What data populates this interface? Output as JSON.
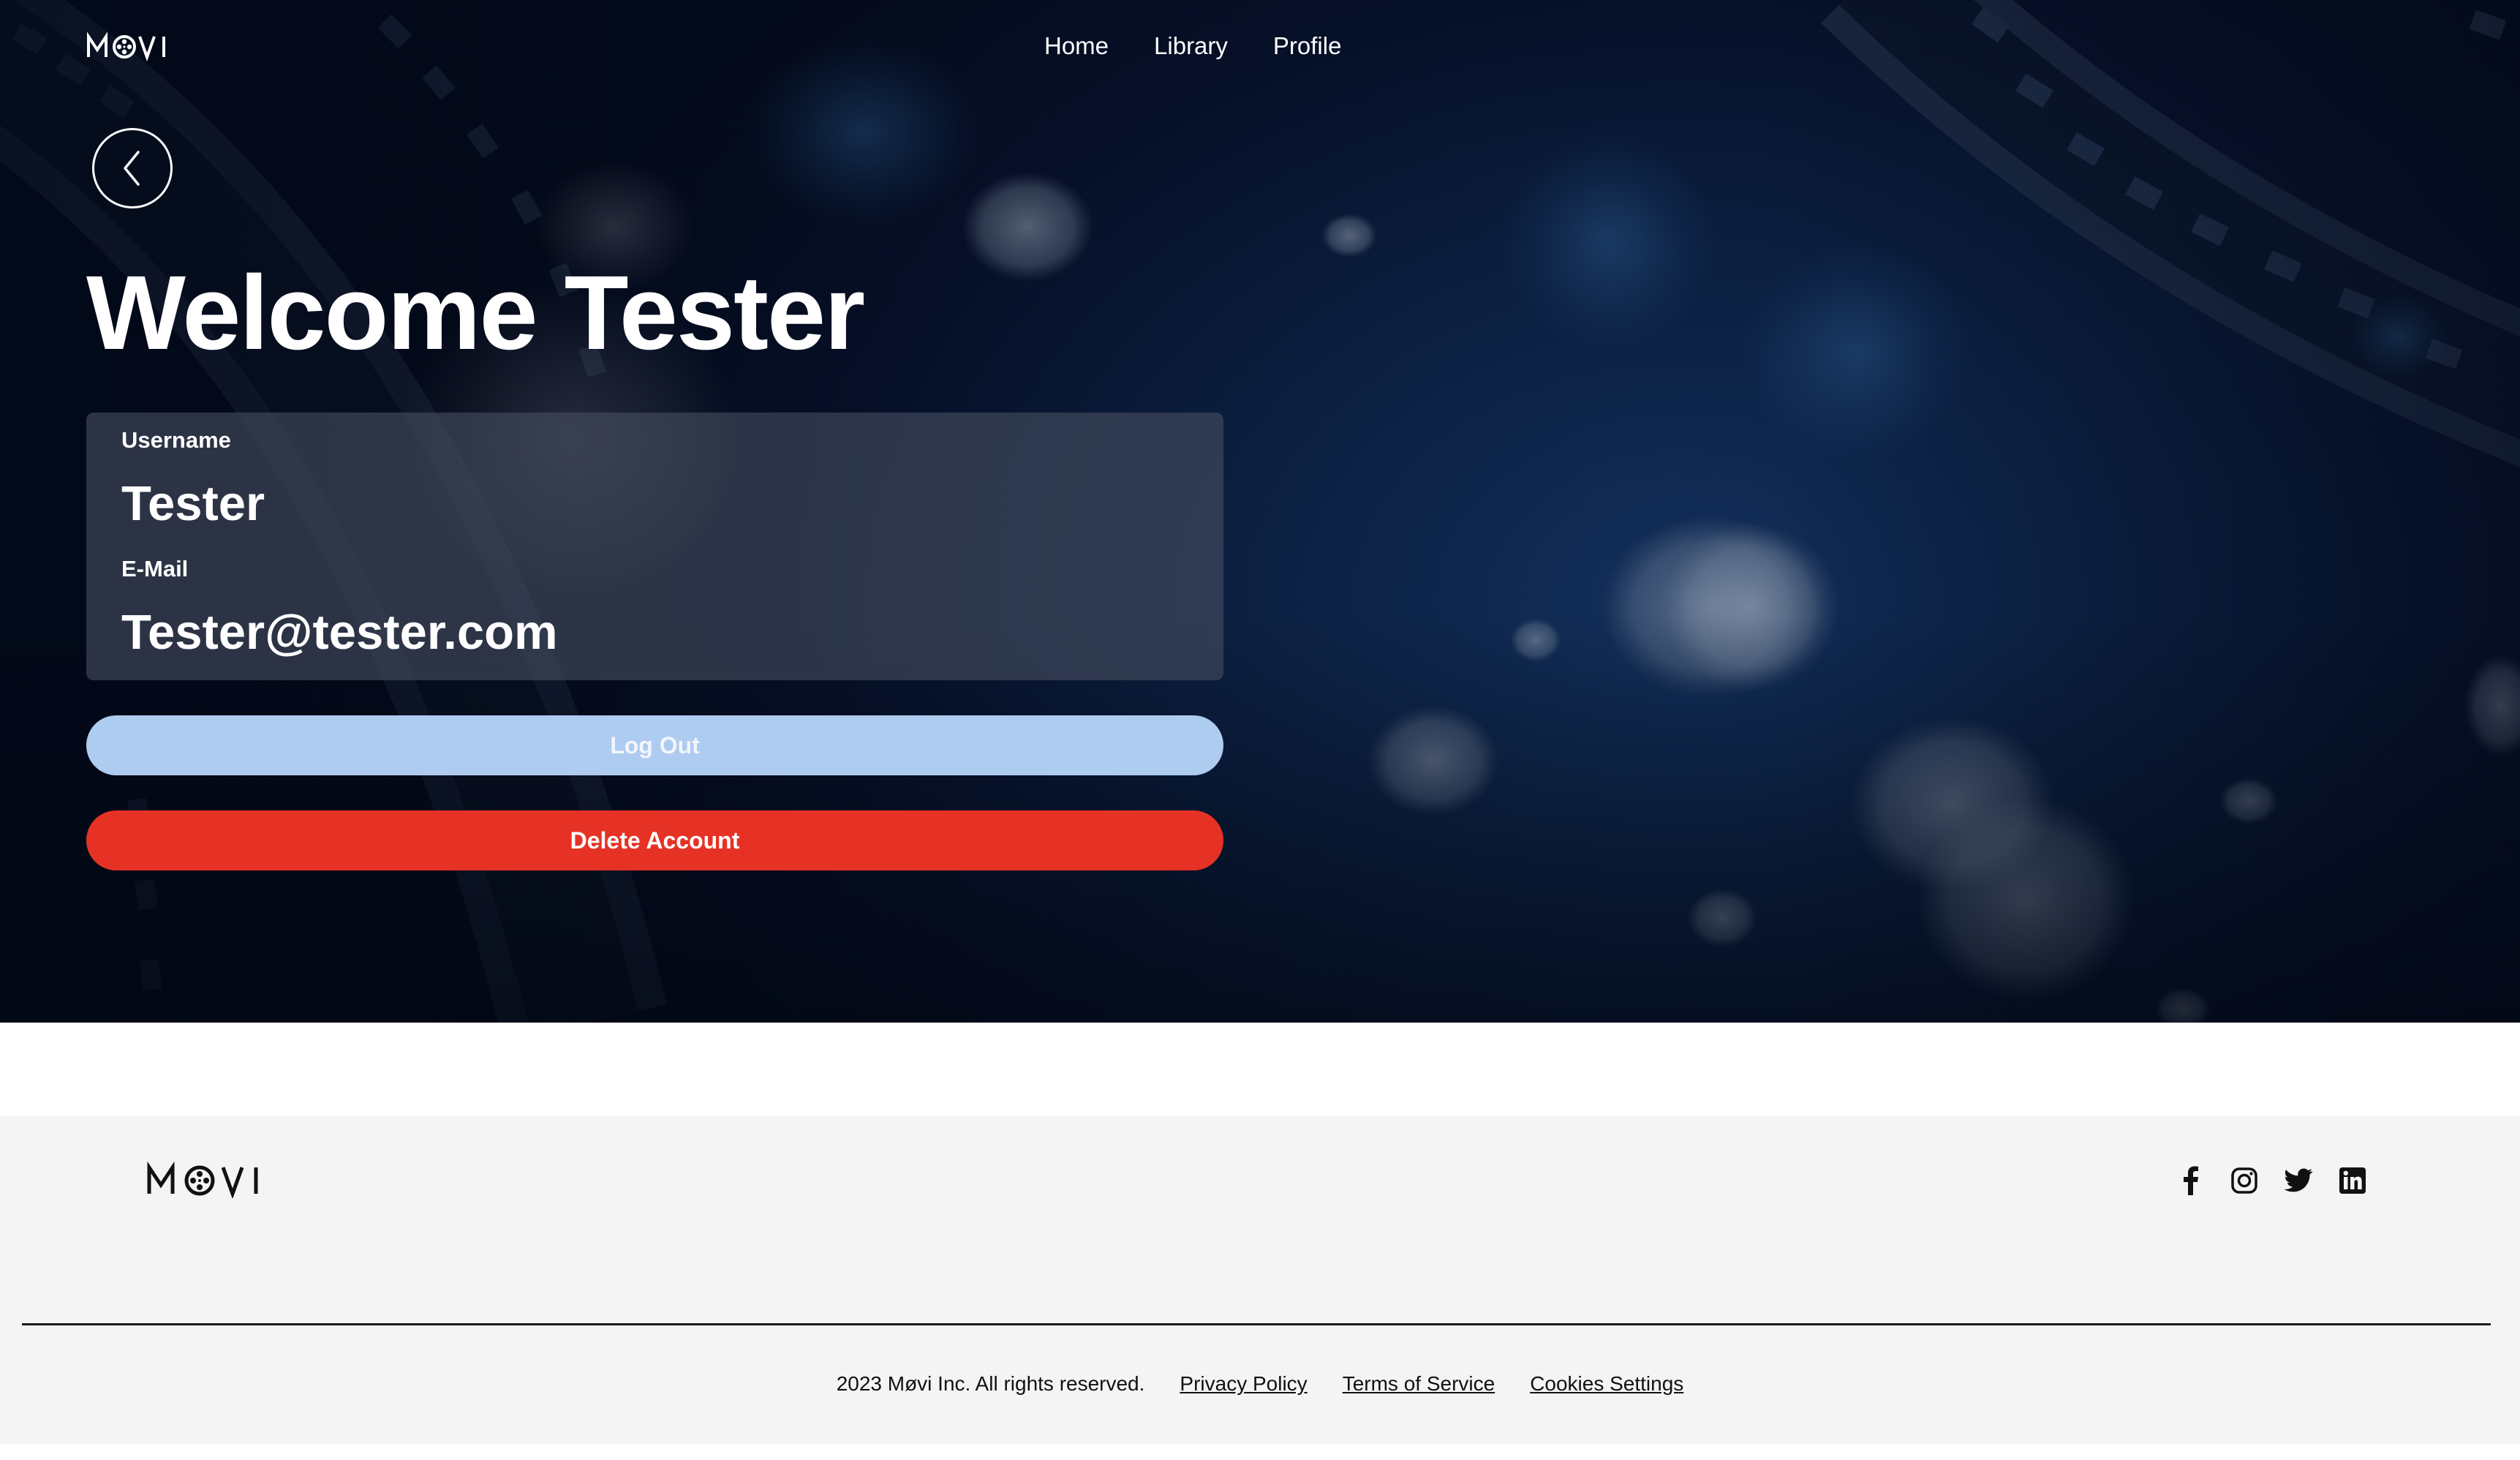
{
  "brand": {
    "name": "MØVI"
  },
  "nav": {
    "items": [
      "Home",
      "Library",
      "Profile"
    ]
  },
  "hero": {
    "title": "Welcome Tester",
    "username_label": "Username",
    "username_value": "Tester",
    "email_label": "E-Mail",
    "email_value": "Tester@tester.com",
    "logout_label": "Log Out",
    "delete_label": "Delete Account"
  },
  "footer": {
    "copyright": "2023 Møvi Inc. All rights reserved.",
    "links": [
      "Privacy Policy",
      "Terms of Service",
      "Cookies Settings"
    ],
    "socials": [
      "facebook-icon",
      "instagram-icon",
      "twitter-icon",
      "linkedin-icon"
    ]
  },
  "colors": {
    "logout_button": "#aecbf0",
    "delete_button": "#e63225",
    "hero_background": "#0b1e3f",
    "footer_background": "#f4f4f4"
  }
}
